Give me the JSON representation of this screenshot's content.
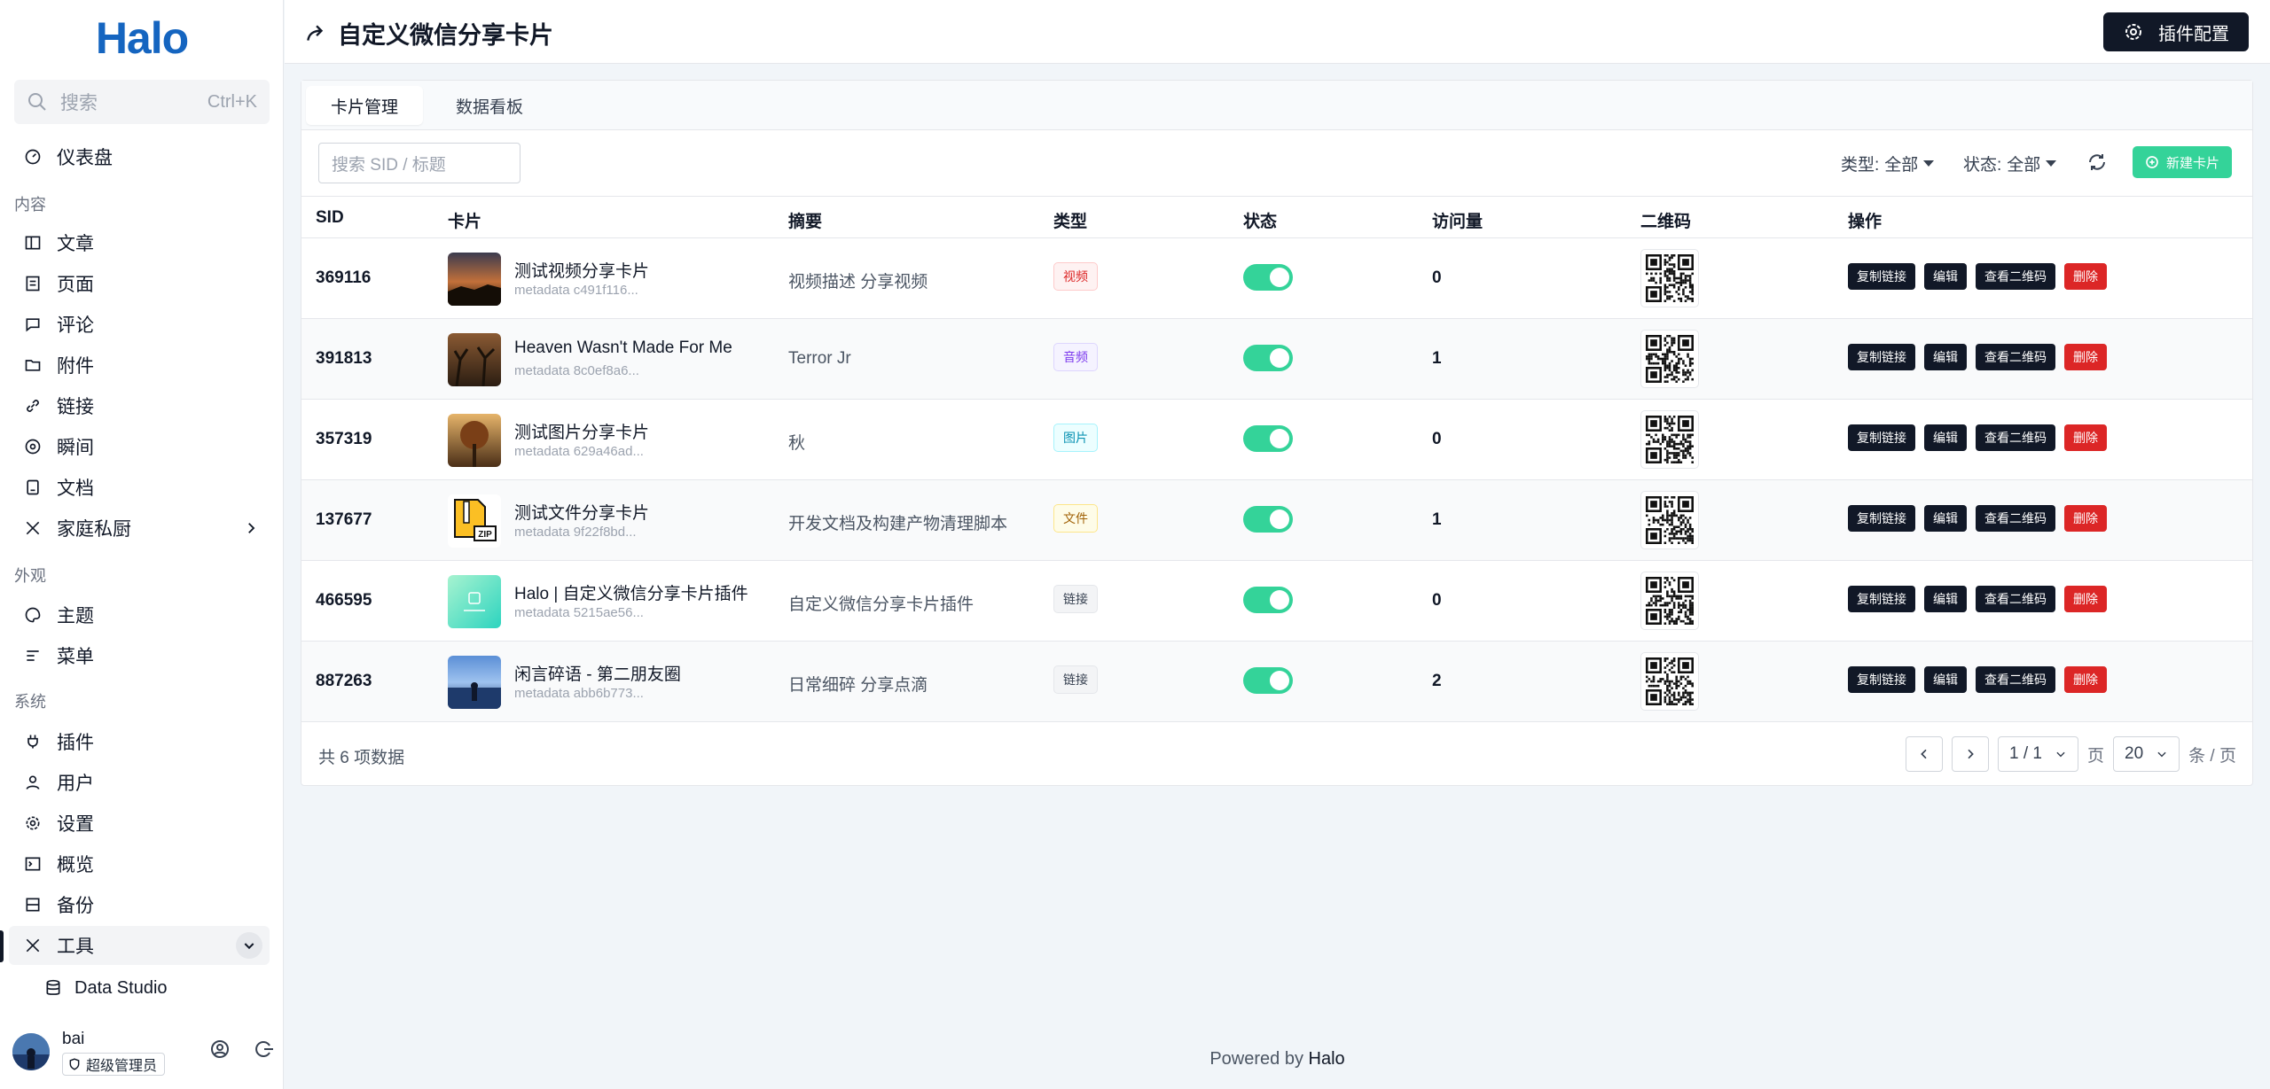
{
  "sidebar": {
    "logo": "Halo",
    "search": {
      "placeholder": "搜索",
      "shortcut": "Ctrl+K"
    },
    "dashboard": "仪表盘",
    "section_content": "内容",
    "content_items": [
      "文章",
      "页面",
      "评论",
      "附件",
      "链接",
      "瞬间",
      "文档",
      "家庭私厨"
    ],
    "section_appearance": "外观",
    "appearance_items": [
      "主题",
      "菜单"
    ],
    "section_system": "系统",
    "system_items": [
      "插件",
      "用户",
      "设置",
      "概览",
      "备份",
      "工具"
    ],
    "sub_item": "Data Studio",
    "user": {
      "name": "bai",
      "role": "超级管理员"
    }
  },
  "header": {
    "title": "自定义微信分享卡片",
    "config_button": "插件配置"
  },
  "tabs": [
    "卡片管理",
    "数据看板"
  ],
  "toolbar": {
    "search_placeholder": "搜索 SID / 标题",
    "type_filter_label": "类型:",
    "type_filter_value": "全部",
    "status_filter_label": "状态:",
    "status_filter_value": "全部",
    "new_button": "新建卡片"
  },
  "table": {
    "columns": [
      "SID",
      "卡片",
      "摘要",
      "类型",
      "状态",
      "访问量",
      "二维码",
      "操作"
    ],
    "action_labels": [
      "复制链接",
      "编辑",
      "查看二维码",
      "删除"
    ],
    "rows": [
      {
        "sid": "369116",
        "title": "测试视频分享卡片",
        "meta": "metadata c491f116...",
        "summary": "视频描述 分享视频",
        "type": "视频",
        "enabled": true,
        "visits": "0"
      },
      {
        "sid": "391813",
        "title": "Heaven Wasn't Made For Me",
        "meta": "metadata 8c0ef8a6...",
        "summary": "Terror Jr",
        "type": "音频",
        "enabled": true,
        "visits": "1"
      },
      {
        "sid": "357319",
        "title": "测试图片分享卡片",
        "meta": "metadata 629a46ad...",
        "summary": "秋",
        "type": "图片",
        "enabled": true,
        "visits": "0"
      },
      {
        "sid": "137677",
        "title": "测试文件分享卡片",
        "meta": "metadata 9f22f8bd...",
        "summary": "开发文档及构建产物清理脚本",
        "type": "文件",
        "enabled": true,
        "visits": "1"
      },
      {
        "sid": "466595",
        "title": "Halo | 自定义微信分享卡片插件",
        "meta": "metadata 5215ae56...",
        "summary": "自定义微信分享卡片插件",
        "type": "链接",
        "enabled": true,
        "visits": "0"
      },
      {
        "sid": "887263",
        "title": "闲言碎语 - 第二朋友圈",
        "meta": "metadata abb6b773...",
        "summary": "日常细碎 分享点滴",
        "type": "链接",
        "enabled": true,
        "visits": "2"
      }
    ]
  },
  "pagination": {
    "total": "共 6 项数据",
    "page": "1 / 1",
    "page_unit": "页",
    "size": "20",
    "size_unit": "条 / 页"
  },
  "footer": {
    "powered_prefix": "Powered by",
    "powered_brand": "Halo"
  },
  "colors": {
    "accent": "#34d399",
    "dark": "#111827",
    "danger": "#dc2626",
    "brand": "#1565c0"
  }
}
